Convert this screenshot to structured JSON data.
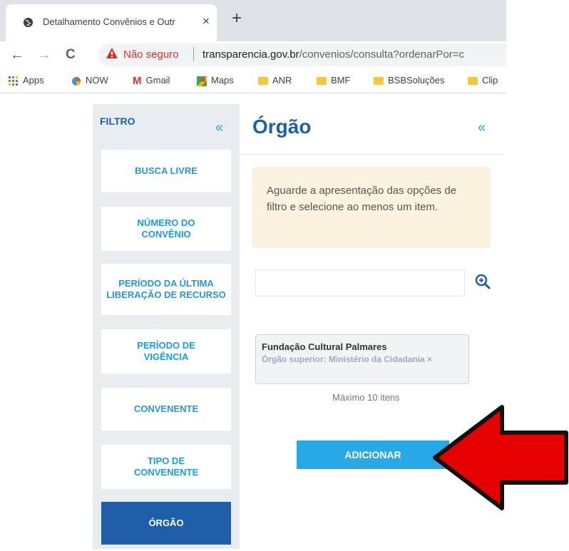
{
  "browser": {
    "tab_title": "Detalhamento Convênios e Outr",
    "tab_close": "×",
    "new_tab": "+",
    "nav_back": "←",
    "nav_forward": "→",
    "reload": "C",
    "security_label": "Não seguro",
    "url_host": "transparencia.gov.br",
    "url_path": "/convenios/consulta?ordenarPor=c",
    "bookmarks": [
      "Apps",
      "NOW",
      "Gmail",
      "Maps",
      "ANR",
      "BMF",
      "BSBSoluções",
      "Clip"
    ]
  },
  "sidebar": {
    "title": "FILTRO",
    "collapse": "«",
    "items": [
      {
        "label": "BUSCA LIVRE"
      },
      {
        "label": "NÚMERO DO CONVÊNIO"
      },
      {
        "label": "PERÍODO DA ÚLTIMA LIBERAÇÃO DE RECURSO"
      },
      {
        "label": "PERÍODO DE VIGÊNCIA"
      },
      {
        "label": "CONVENENTE"
      },
      {
        "label": "TIPO DE CONVENENTE"
      },
      {
        "label": "ÓRGÃO"
      }
    ]
  },
  "panel": {
    "title": "Órgão",
    "collapse": "«",
    "notice": "Aguarde a apresentação das opções de filtro e selecione ao menos um item.",
    "search_placeholder": "",
    "selected": {
      "name": "Fundação Cultural Palmares",
      "subtitle": "Órgão superior: Ministério da Cidadania ×"
    },
    "max_items": "Máximo 10 itens",
    "add_button": "ADICIONAR"
  },
  "colors": {
    "brand_blue": "#1f5ea8",
    "link_blue": "#2199d9",
    "button_blue": "#28a8e4",
    "notice_bg": "#fbf3df",
    "annotation_arrow": "#e60000"
  }
}
